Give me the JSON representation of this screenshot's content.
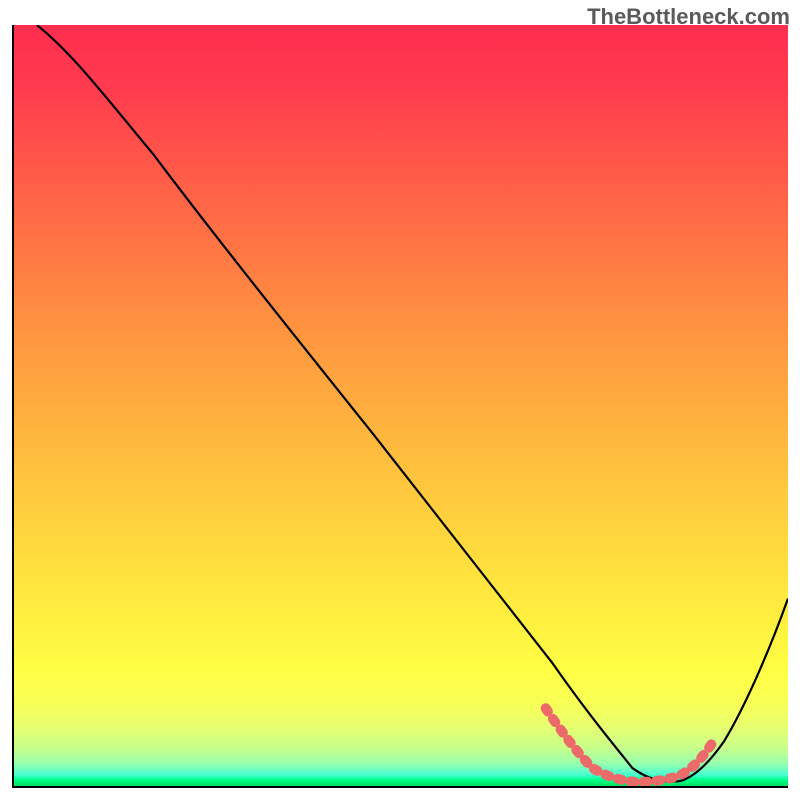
{
  "watermark": "TheBottleneck.com",
  "chart_data": {
    "type": "line",
    "title": "",
    "xlabel": "",
    "ylabel": "",
    "xlim": [
      0,
      100
    ],
    "ylim": [
      0,
      100
    ],
    "grid": false,
    "legend": false,
    "gradient_background": {
      "top_color": "#ff2e4f",
      "bottom_color": "#00e060",
      "description": "vertical rainbow gradient red-orange-yellow-green acting as heatmap background"
    },
    "series": [
      {
        "name": "main-curve",
        "color": "#000000",
        "x": [
          3,
          10,
          20,
          30,
          40,
          50,
          60,
          65,
          68,
          70,
          72,
          75,
          78,
          80,
          82,
          84,
          86,
          88,
          90,
          95,
          100
        ],
        "y": [
          100,
          95,
          84,
          72,
          60,
          48,
          36,
          28,
          20,
          14,
          8,
          4,
          1,
          0,
          0,
          0,
          0,
          2,
          5,
          16,
          30
        ]
      },
      {
        "name": "optimal-segment",
        "color": "#ed6a6a",
        "stroke_width": 8,
        "dash": "3,3",
        "x": [
          68,
          70,
          72,
          74,
          76,
          78,
          80,
          82,
          84,
          86,
          88
        ],
        "y": [
          10,
          6,
          3,
          1.5,
          0.8,
          0.5,
          0.5,
          0.5,
          0.7,
          1.2,
          3
        ]
      }
    ],
    "minimum_point": {
      "x": 81,
      "y": 0
    }
  }
}
